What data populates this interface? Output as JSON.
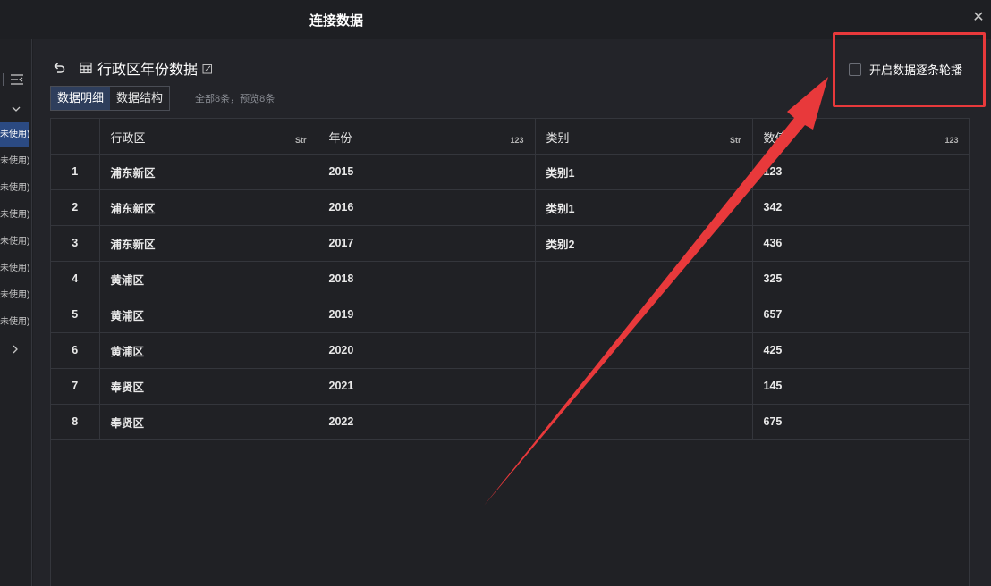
{
  "dialog": {
    "title": "连接数据",
    "close_icon": "close-icon"
  },
  "sidebar": {
    "items": [
      {
        "label": "未使用)",
        "active": true
      },
      {
        "label": "未使用)",
        "active": false
      },
      {
        "label": "未使用)",
        "active": false
      },
      {
        "label": "未使用)",
        "active": false
      },
      {
        "label": "未使用)",
        "active": false
      },
      {
        "label": "未使用)",
        "active": false
      },
      {
        "label": "未使用)",
        "active": false
      },
      {
        "label": "未使用)",
        "active": false
      }
    ]
  },
  "header": {
    "dataset_name": "行政区年份数据",
    "tabs": [
      {
        "label": "数据明细",
        "active": true
      },
      {
        "label": "数据结构",
        "active": false
      }
    ],
    "count_text": "全部8条，预览8条",
    "carousel_label": "开启数据逐条轮播",
    "carousel_checked": false
  },
  "table": {
    "columns": [
      {
        "label": "",
        "type": ""
      },
      {
        "label": "行政区",
        "type": "Str"
      },
      {
        "label": "年份",
        "type": "123"
      },
      {
        "label": "类别",
        "type": "Str"
      },
      {
        "label": "数值",
        "type": "123"
      }
    ],
    "rows": [
      [
        "1",
        "浦东新区",
        "2015",
        "类别1",
        "123"
      ],
      [
        "2",
        "浦东新区",
        "2016",
        "类别1",
        "342"
      ],
      [
        "3",
        "浦东新区",
        "2017",
        "类别2",
        "436"
      ],
      [
        "4",
        "黄浦区",
        "2018",
        "",
        "325"
      ],
      [
        "5",
        "黄浦区",
        "2019",
        "",
        "657"
      ],
      [
        "6",
        "黄浦区",
        "2020",
        "",
        "425"
      ],
      [
        "7",
        "奉贤区",
        "2021",
        "",
        "145"
      ],
      [
        "8",
        "奉贤区",
        "2022",
        "",
        "675"
      ]
    ]
  },
  "colors": {
    "accent": "#2b4a82",
    "highlight": "#e8393b",
    "background": "#232429"
  }
}
